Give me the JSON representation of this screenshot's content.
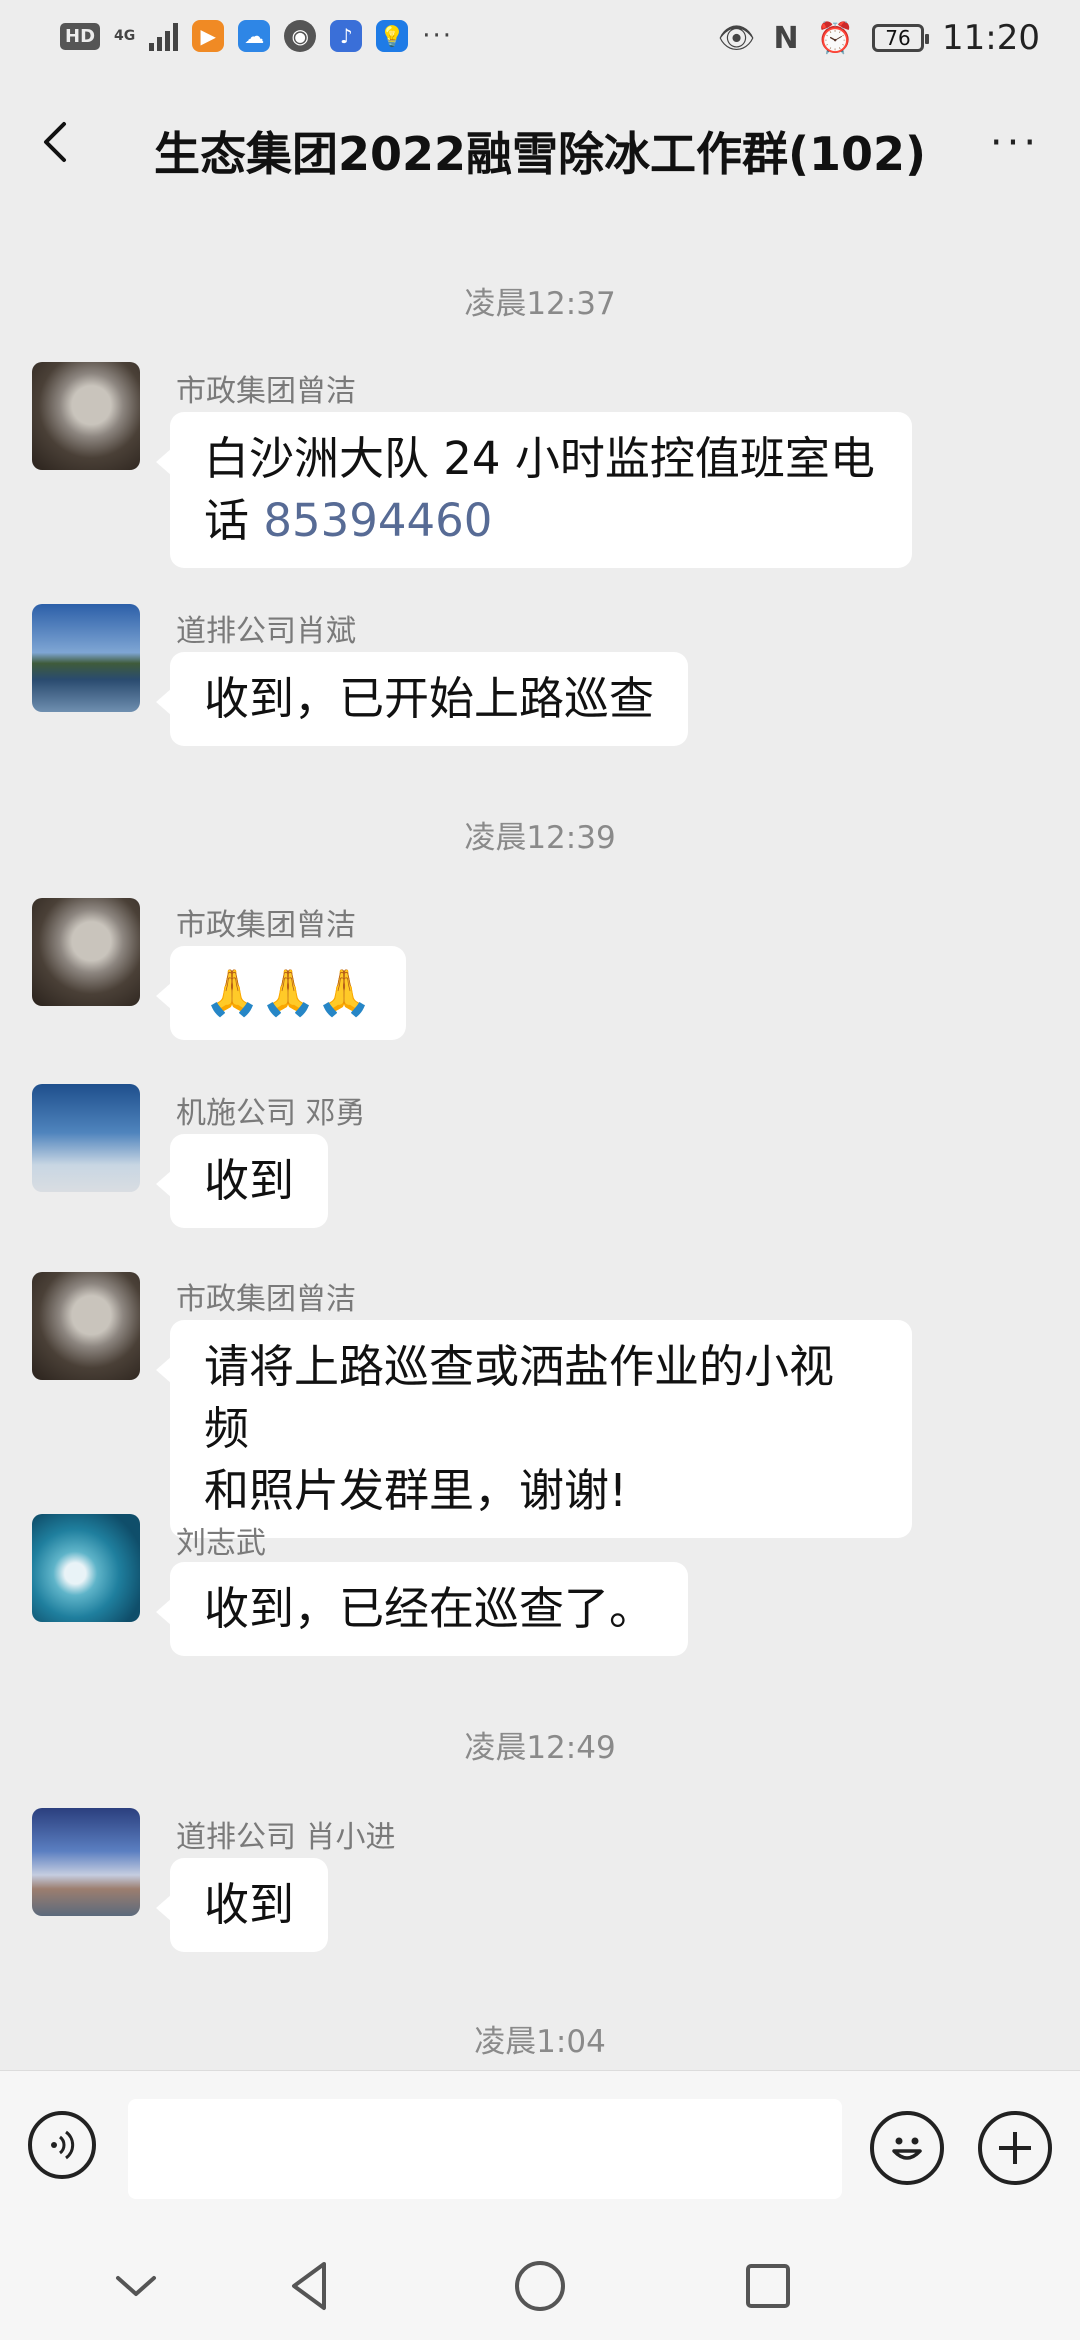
{
  "status_bar": {
    "hd": "HD",
    "network": "4G",
    "battery": "76",
    "time": "11:20",
    "more": "···"
  },
  "header": {
    "title": "生态集团2022融雪除冰工作群(102)",
    "back_icon": "chevron-left-icon",
    "more_icon": "more-dots-icon",
    "more": "···"
  },
  "messages": [
    {
      "type": "time",
      "text": "凌晨12:37"
    },
    {
      "type": "msg",
      "sender": "市政集团曾洁",
      "line1": "白沙洲大队 24 小时监控值班室电",
      "line2_prefix": "话 ",
      "phone": "85394460"
    },
    {
      "type": "msg",
      "sender": "道排公司肖斌",
      "text": "收到，已开始上路巡查"
    },
    {
      "type": "time",
      "text": "凌晨12:39"
    },
    {
      "type": "msg",
      "sender": "市政集团曾洁",
      "text": "🙏🙏🙏"
    },
    {
      "type": "msg",
      "sender": "机施公司 邓勇",
      "text": "收到"
    },
    {
      "type": "msg",
      "sender": "市政集团曾洁",
      "line1": "请将上路巡查或洒盐作业的小视频",
      "line2": "和照片发群里，谢谢!"
    },
    {
      "type": "msg",
      "sender": "刘志武",
      "text": "收到，已经在巡查了。"
    },
    {
      "type": "time",
      "text": "凌晨12:49"
    },
    {
      "type": "msg",
      "sender": "道排公司 肖小进",
      "text": "收到"
    },
    {
      "type": "time",
      "text": "凌晨1:04"
    }
  ],
  "input_bar": {
    "placeholder": "",
    "voice_icon": "voice-icon",
    "emoji_icon": "emoji-icon",
    "plus_icon": "plus-icon"
  },
  "nav_bar": {
    "icons": [
      "collapse-icon",
      "back-triangle-icon",
      "home-circle-icon",
      "recents-square-icon"
    ]
  }
}
